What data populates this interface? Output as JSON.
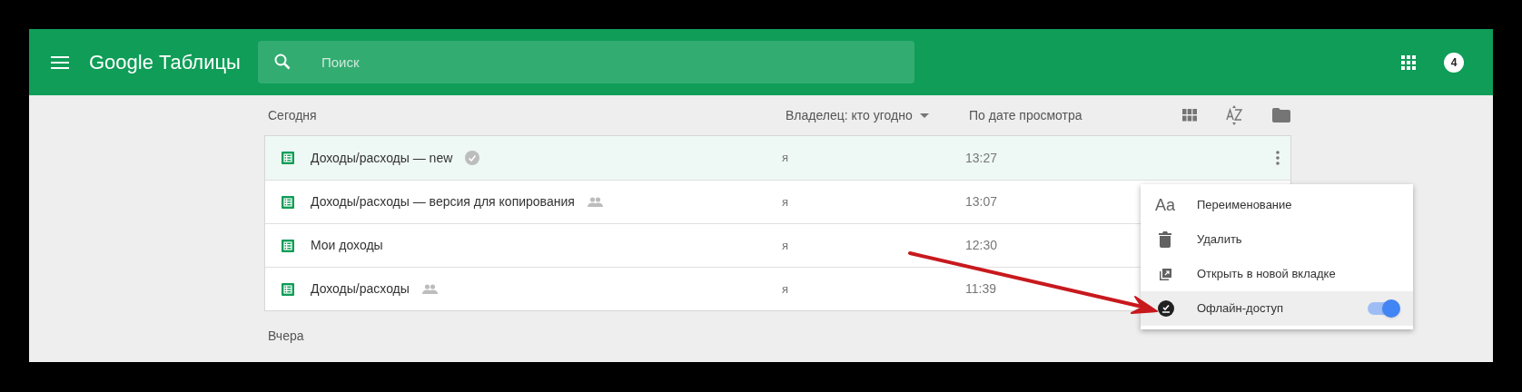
{
  "header": {
    "title": "Google Таблицы",
    "search": {
      "placeholder": "Поиск"
    },
    "account_badge": "4"
  },
  "list": {
    "section": "Сегодня",
    "owner_filter": "Владелец: кто угодно",
    "sort": "По дате просмотра",
    "rows": [
      {
        "name": "Доходы/расходы — new",
        "kind": "offline",
        "owner": "я",
        "time": "13:27",
        "selected": true
      },
      {
        "name": "Доходы/расходы — версия для копирования",
        "kind": "shared",
        "owner": "я",
        "time": "13:07",
        "selected": false
      },
      {
        "name": "Мои доходы",
        "owner": "я",
        "time": "12:30",
        "selected": false
      },
      {
        "name": "Доходы/расходы",
        "kind": "shared",
        "owner": "я",
        "time": "11:39",
        "selected": false
      }
    ],
    "next_section": "Вчера"
  },
  "context_menu": {
    "items": [
      {
        "kind": "rename",
        "icon_text": "Aa",
        "label": "Переименование",
        "selected": false
      },
      {
        "kind": "delete",
        "label": "Удалить",
        "selected": false
      },
      {
        "kind": "open",
        "label": "Открыть в новой вкладке",
        "selected": false
      },
      {
        "kind": "offline",
        "label": "Офлайн-доступ",
        "selected": true,
        "on": true
      }
    ]
  }
}
